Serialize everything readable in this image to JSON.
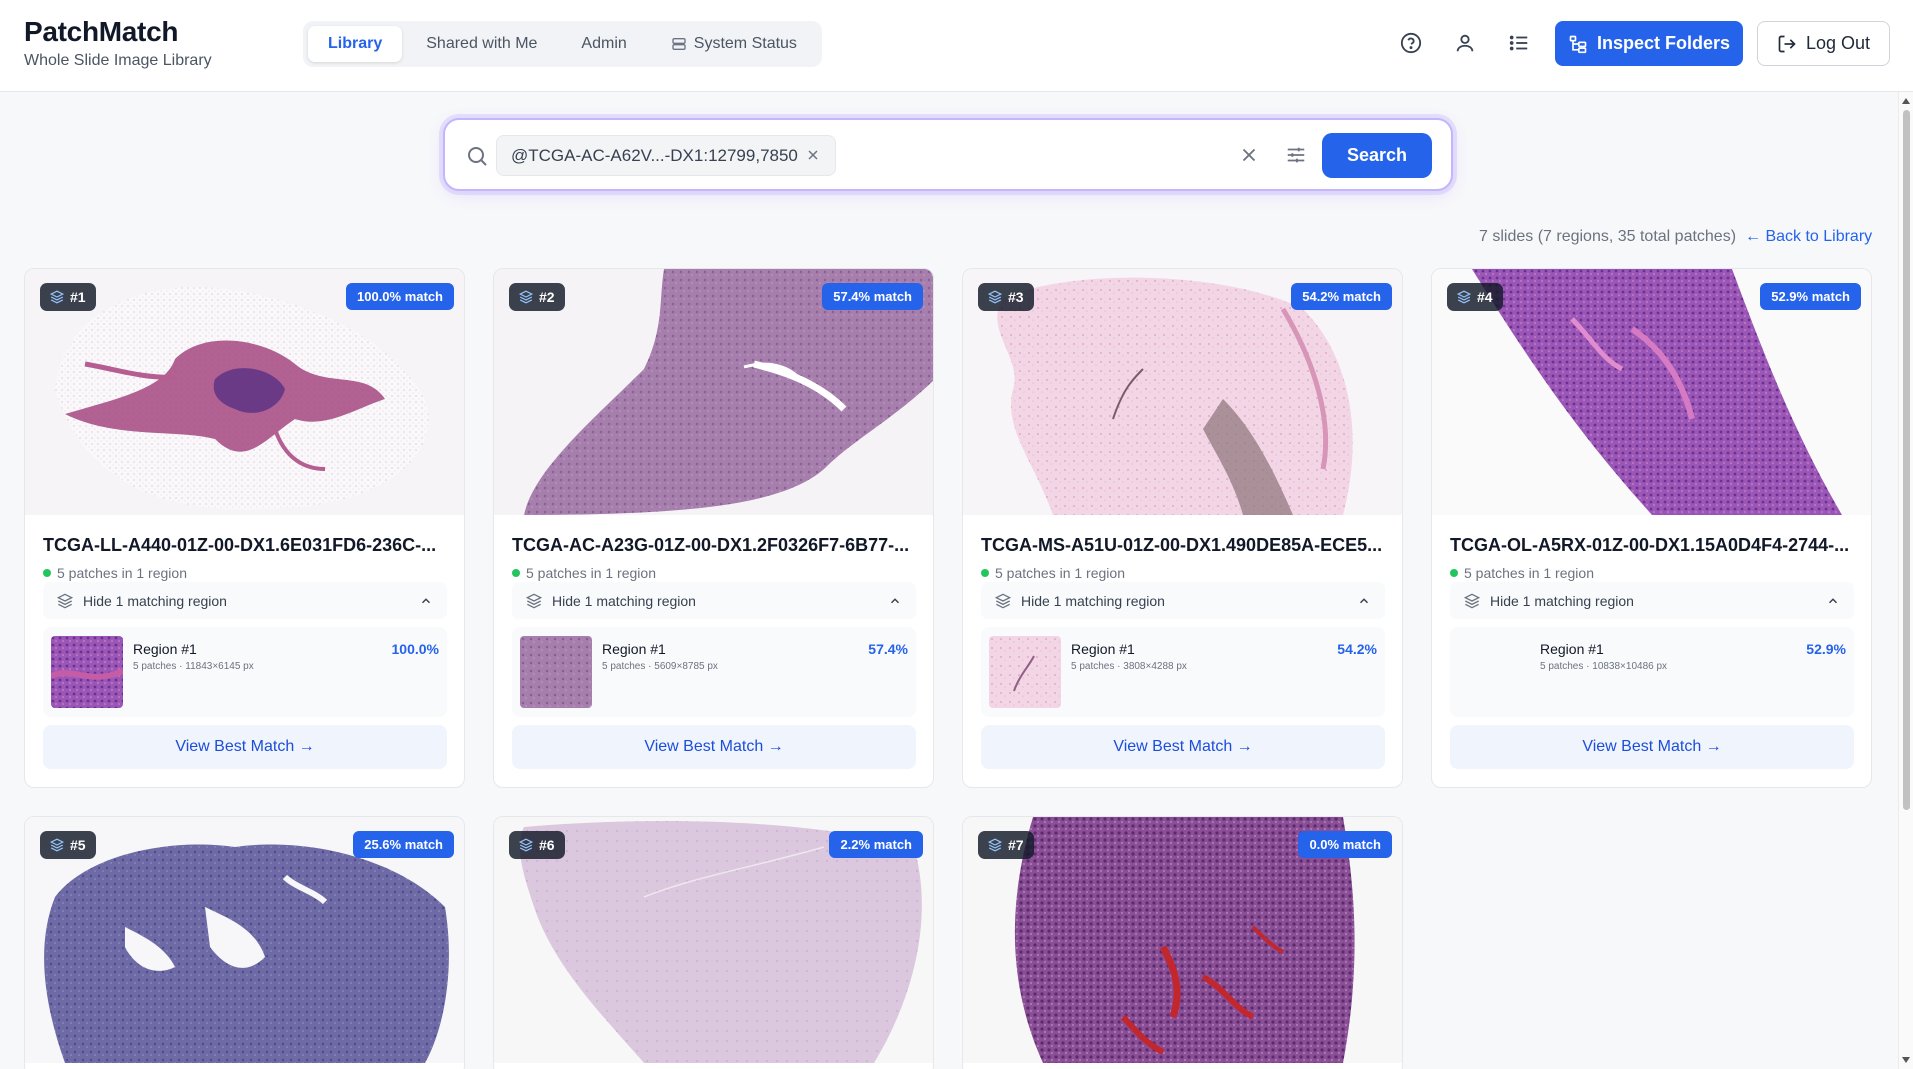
{
  "brand": {
    "title": "PatchMatch",
    "subtitle": "Whole Slide Image Library"
  },
  "nav": {
    "tabs": [
      {
        "label": "Library",
        "active": true
      },
      {
        "label": "Shared with Me",
        "active": false
      },
      {
        "label": "Admin",
        "active": false
      },
      {
        "label": "System Status",
        "active": false,
        "icon": "server-icon"
      }
    ]
  },
  "header_actions": {
    "icons": [
      "help-circle-icon",
      "user-icon",
      "list-icon"
    ],
    "inspect_label": "Inspect Folders",
    "logout_label": "Log Out"
  },
  "search": {
    "chip_text": "@TCGA-AC-A62V...-DX1:12799,7850",
    "button_label": "Search"
  },
  "results": {
    "summary": "7 slides (7 regions, 35 total patches)",
    "back_label": "← Back to Library"
  },
  "colors": {
    "accent": "#2563eb",
    "status_dot": "#22c55e"
  },
  "cards": [
    {
      "rank": "#1",
      "match": "100.0% match",
      "name": "TCGA-LL-A440-01Z-00-DX1.6E031FD6-236C-...",
      "patches": "5 patches in 1 region",
      "toggle": "Hide 1 matching region",
      "region_title": "Region #1",
      "region_sub": "5 patches · 11843×6145 px",
      "region_score": "100.0%",
      "view_label": "View Best Match →"
    },
    {
      "rank": "#2",
      "match": "57.4% match",
      "name": "TCGA-AC-A23G-01Z-00-DX1.2F0326F7-6B77-...",
      "patches": "5 patches in 1 region",
      "toggle": "Hide 1 matching region",
      "region_title": "Region #1",
      "region_sub": "5 patches · 5609×8785 px",
      "region_score": "57.4%",
      "view_label": "View Best Match →"
    },
    {
      "rank": "#3",
      "match": "54.2% match",
      "name": "TCGA-MS-A51U-01Z-00-DX1.490DE85A-ECE5...",
      "patches": "5 patches in 1 region",
      "toggle": "Hide 1 matching region",
      "region_title": "Region #1",
      "region_sub": "5 patches · 3808×4288 px",
      "region_score": "54.2%",
      "view_label": "View Best Match →"
    },
    {
      "rank": "#4",
      "match": "52.9% match",
      "name": "TCGA-OL-A5RX-01Z-00-DX1.15A0D4F4-2744-...",
      "patches": "5 patches in 1 region",
      "toggle": "Hide 1 matching region",
      "region_title": "Region #1",
      "region_sub": "5 patches · 10838×10486 px",
      "region_score": "52.9%",
      "view_label": "View Best Match →"
    },
    {
      "rank": "#5",
      "match": "25.6% match"
    },
    {
      "rank": "#6",
      "match": "2.2% match"
    },
    {
      "rank": "#7",
      "match": "0.0% match"
    }
  ]
}
